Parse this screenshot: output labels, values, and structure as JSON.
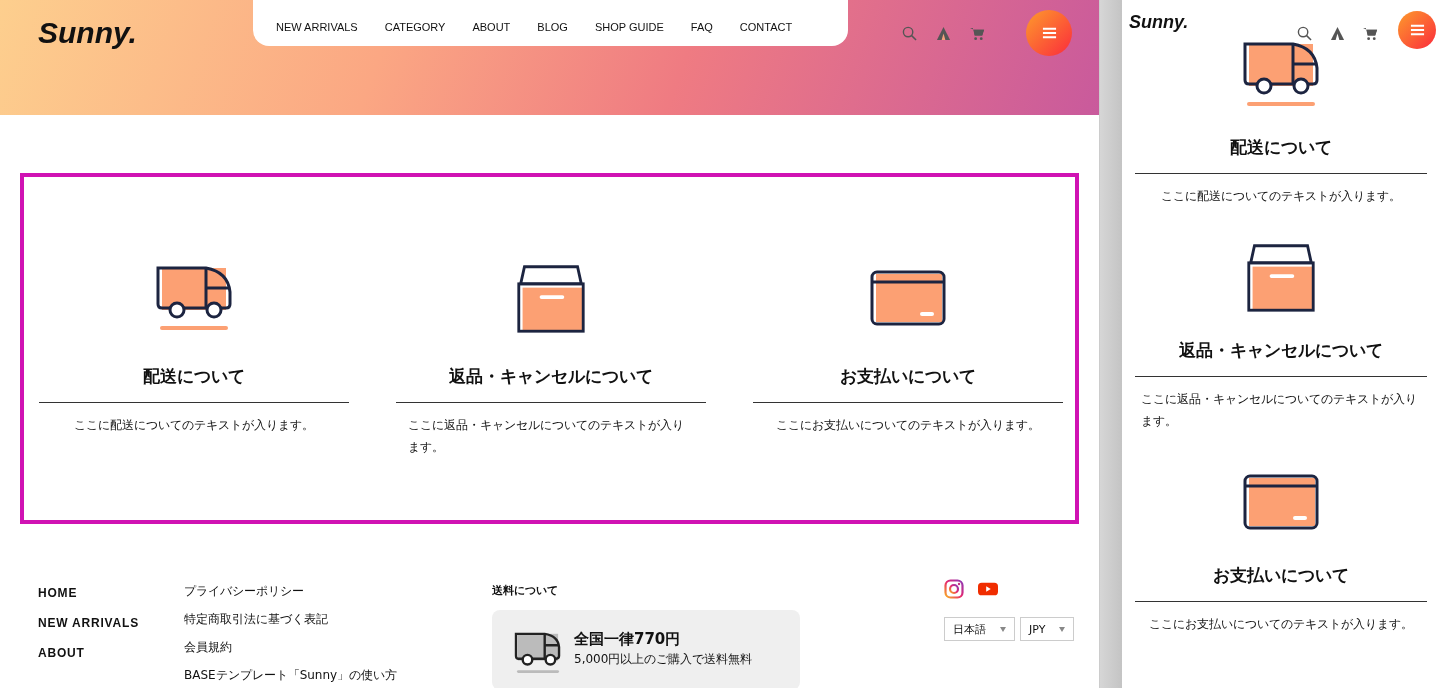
{
  "header": {
    "logo": "Sunny.",
    "nav": [
      "NEW ARRIVALS",
      "CATEGORY",
      "ABOUT",
      "BLOG",
      "SHOP GUIDE",
      "FAQ",
      "CONTACT"
    ]
  },
  "features": [
    {
      "kind": "truck",
      "title": "配送について",
      "text": "ここに配送についてのテキストが入ります。"
    },
    {
      "kind": "box",
      "title": "返品・キャンセルについて",
      "text": "ここに返品・キャンセルについてのテキストが入ります。"
    },
    {
      "kind": "card",
      "title": "お支払いについて",
      "text": "ここにお支払いについてのテキストが入ります。"
    }
  ],
  "footer": {
    "main_links": [
      "HOME",
      "NEW ARRIVALS",
      "ABOUT"
    ],
    "sub_links": [
      "プライバシーポリシー",
      "特定商取引法に基づく表記",
      "会員規約",
      "BASEテンプレート「Sunny」の使い方"
    ],
    "shipping": {
      "heading": "送料について",
      "title": "全国一律770円",
      "note": "5,000円以上のご購入で送料無料"
    },
    "language": "日本語",
    "currency": "JPY"
  },
  "mobile": {
    "logo": "Sunny.",
    "features": [
      {
        "kind": "truck",
        "title": "配送について",
        "text": "ここに配送についてのテキストが入ります。"
      },
      {
        "kind": "box",
        "title": "返品・キャンセルについて",
        "text": "ここに返品・キャンセルについてのテキストが入ります。"
      },
      {
        "kind": "card",
        "title": "お支払いについて",
        "text": "ここにお支払いについてのテキストが入ります。"
      }
    ]
  }
}
